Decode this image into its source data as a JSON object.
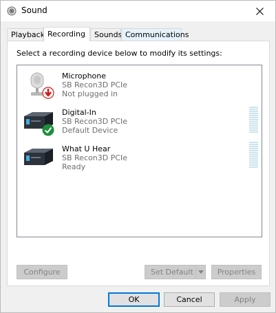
{
  "window": {
    "title": "Sound"
  },
  "tabs": [
    {
      "label": "Playback"
    },
    {
      "label": "Recording"
    },
    {
      "label": "Sounds"
    },
    {
      "label": "Communications"
    }
  ],
  "instruction": "Select a recording device below to modify its settings:",
  "devices": [
    {
      "name": "Microphone",
      "driver": "SB Recon3D PCIe",
      "status": "Not plugged in",
      "badge": "red-down-arrow"
    },
    {
      "name": "Digital-In",
      "driver": "SB Recon3D PCIe",
      "status": "Default Device",
      "badge": "green-check"
    },
    {
      "name": "What U Hear",
      "driver": "SB Recon3D PCIe",
      "status": "Ready",
      "badge": "none"
    }
  ],
  "buttons": {
    "configure": "Configure",
    "set_default": "Set Default",
    "properties": "Properties",
    "ok": "OK",
    "cancel": "Cancel",
    "apply": "Apply"
  },
  "colors": {
    "accent": "#0078d7",
    "meter": "#c9e4ec",
    "check": "#1e8e3e",
    "alert": "#d01919"
  }
}
